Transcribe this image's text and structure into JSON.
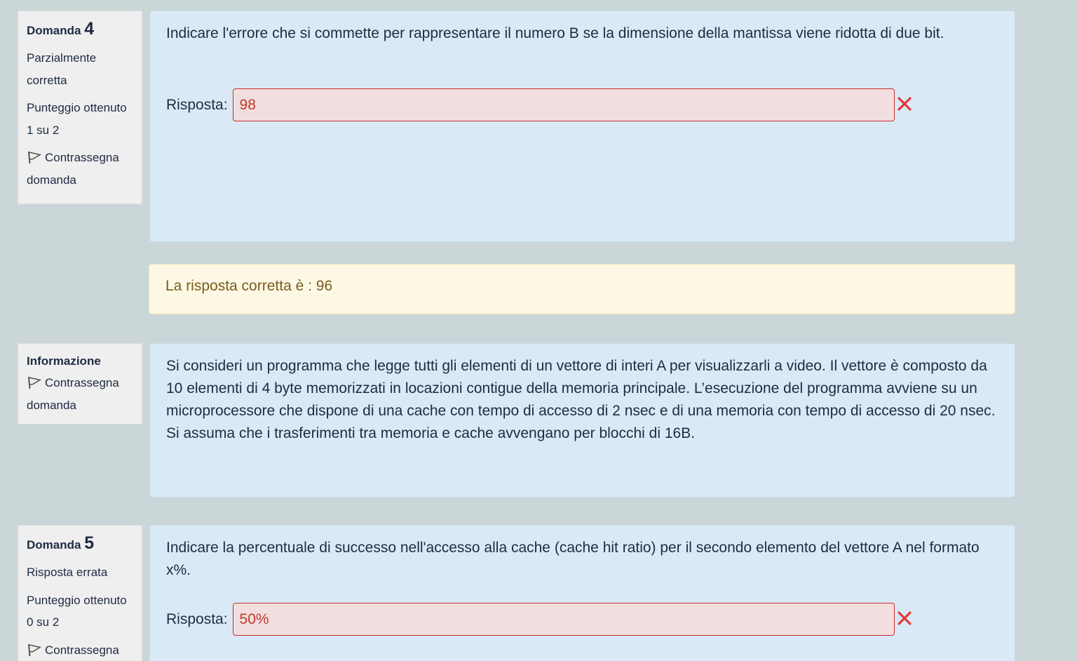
{
  "q4": {
    "label": "Domanda",
    "number": "4",
    "state": "Parzialmente corretta",
    "grade_label": "Punteggio ottenuto",
    "grade_value": "1 su 2",
    "flag_label": "Contrassegna domanda",
    "text": "Indicare l'errore che si commette per rappresentare il numero B se la dimensione della mantissa viene ridotta di due bit.",
    "answer_label": "Risposta:",
    "answer_value": "98",
    "feedback": "La risposta corretta è : 96"
  },
  "info": {
    "label": "Informazione",
    "flag_label": "Contrassegna domanda",
    "text": "Si consideri un programma che legge tutti gli elementi di un vettore di interi A per visualizzarli a video. Il vettore è composto da 10 elementi di 4 byte memorizzati in locazioni contigue della memoria principale. L’esecuzione del programma avviene su un microprocessore che dispone di una cache con tempo di accesso di 2 nsec e di una memoria con tempo di accesso di 20 nsec. Si assuma che i trasferimenti tra memoria e cache avvengano per blocchi di 16B."
  },
  "q5": {
    "label": "Domanda",
    "number": "5",
    "state": "Risposta errata",
    "grade_label": "Punteggio ottenuto",
    "grade_value": "0 su 2",
    "flag_label": "Contrassegna",
    "text": "Indicare la percentuale di successo nell'accesso alla cache (cache hit ratio) per il secondo elemento del vettore A nel formato x%.",
    "answer_label": "Risposta:",
    "answer_value": "50%"
  },
  "colors": {
    "page_bg": "#cbd6d8",
    "question_bg": "#d9eaf6",
    "feedback_bg": "#fcf8e3",
    "incorrect_red": "#e53935"
  },
  "icons": {
    "flag": "flag-icon",
    "incorrect": "close-icon"
  }
}
